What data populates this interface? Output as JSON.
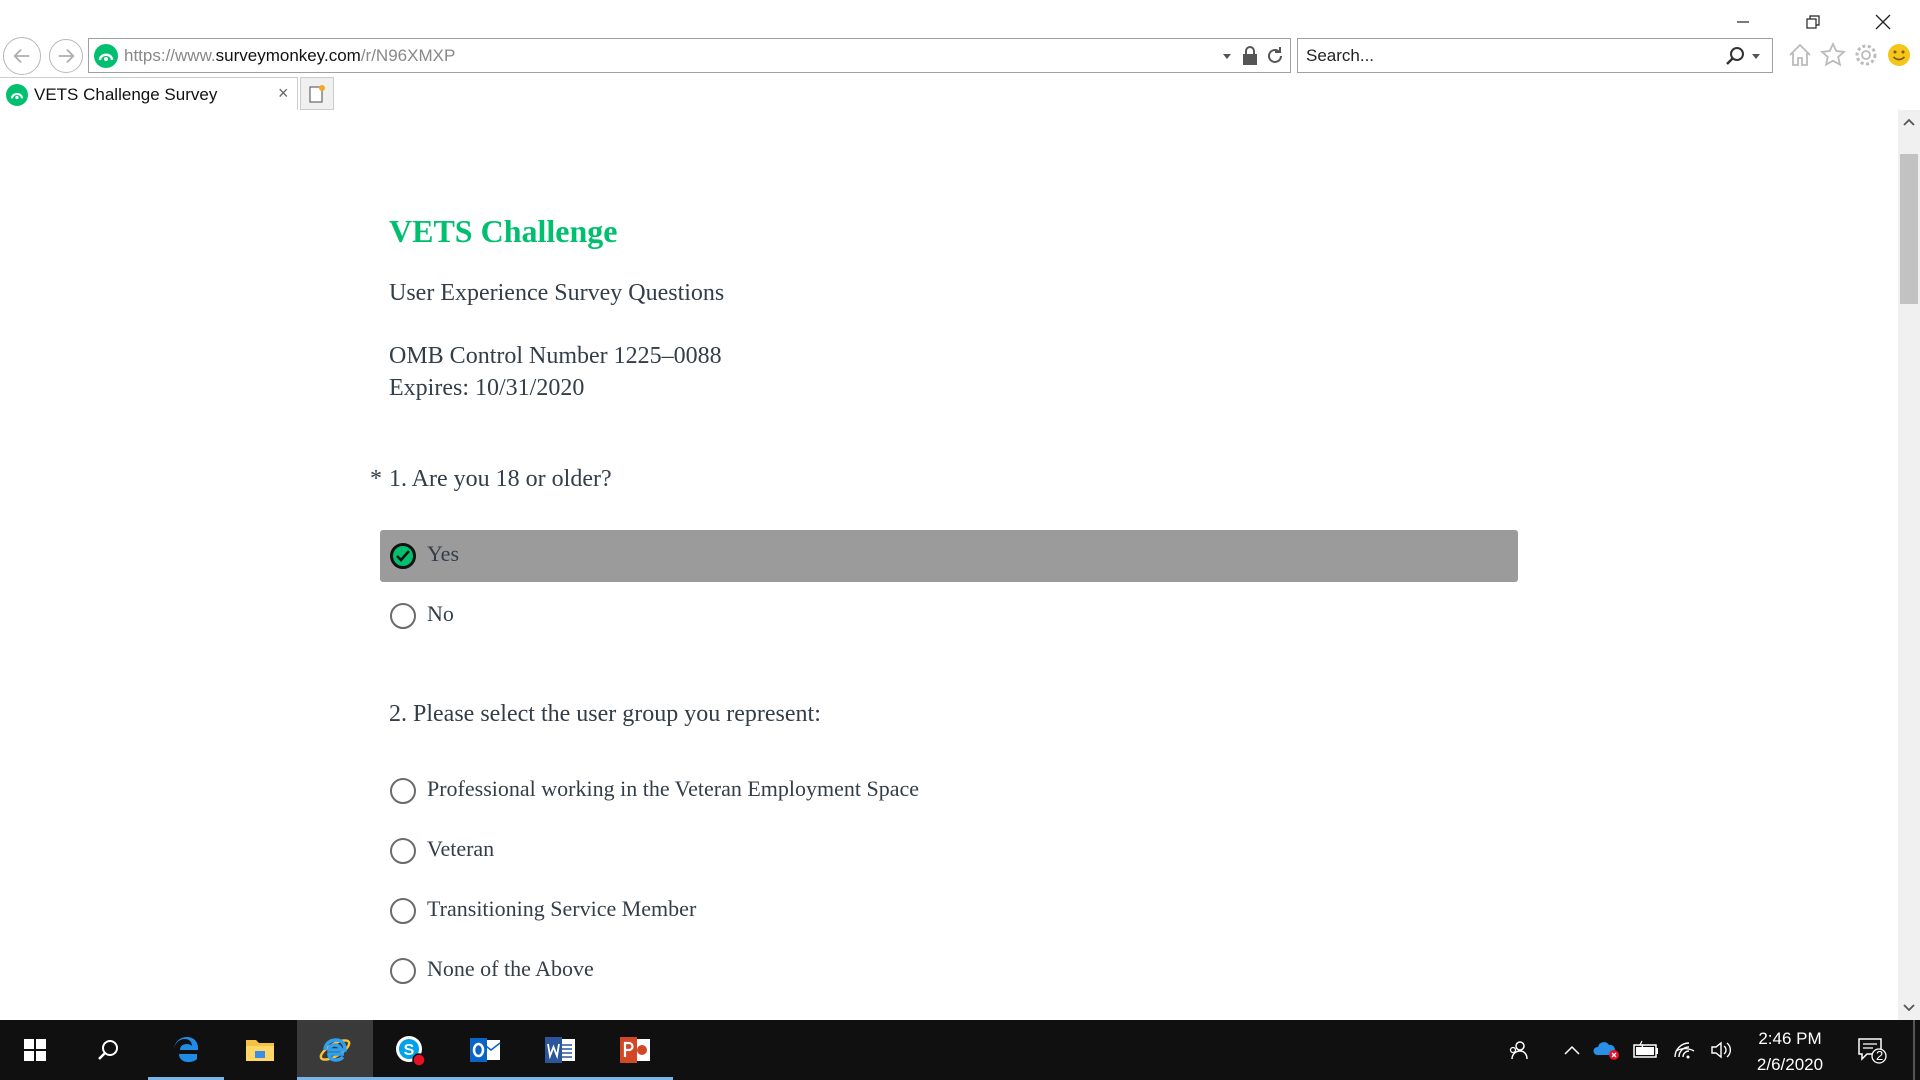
{
  "browser": {
    "url_prefix": "https://www.",
    "url_host": "surveymonkey.com",
    "url_path": "/r/N96XMXP",
    "search_placeholder": "Search...",
    "tab_title": "VETS Challenge Survey",
    "tab_close": "×"
  },
  "survey": {
    "title": "VETS Challenge",
    "subtitle": "User Experience Survey Questions",
    "omb_number": "OMB Control Number 1225–0088",
    "expires": "Expires: 10/31/2020"
  },
  "questions": [
    {
      "required_mark": "*",
      "title": "1. Are you 18 or older?",
      "options": [
        "Yes",
        "No"
      ],
      "selected": "Yes"
    },
    {
      "title": "2. Please select the user group you represent:",
      "options": [
        "Professional working in the Veteran Employment Space",
        "Veteran",
        "Transitioning Service Member",
        "None of the Above"
      ]
    }
  ],
  "taskbar": {
    "time": "2:46 PM",
    "date": "2/6/2020",
    "notification_count": "2"
  },
  "colors": {
    "brand_green": "#00bf6f",
    "selected_bg": "#9b9b9b",
    "taskbar_bg": "#101010"
  }
}
